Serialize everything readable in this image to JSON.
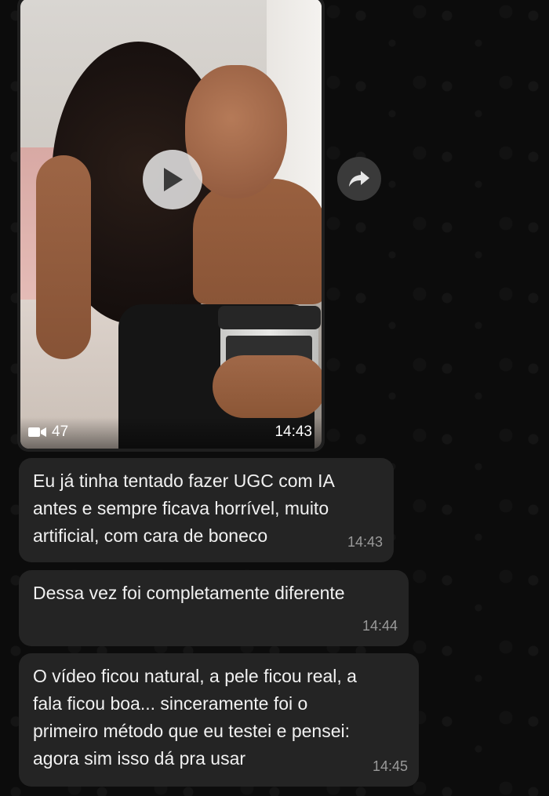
{
  "video_message": {
    "duration": "47",
    "time": "14:43",
    "play_icon": "play-icon",
    "video_icon": "video-camera-icon",
    "forward_icon": "forward-icon"
  },
  "messages": [
    {
      "text": "Eu já tinha tentado fazer UGC com IA\nantes e sempre ficava horrível, muito\nartificial, com cara de boneco",
      "time": "14:43"
    },
    {
      "text": "Dessa vez foi completamente diferente",
      "time": "14:44"
    },
    {
      "text": "O vídeo ficou natural, a pele ficou real, a\nfala ficou boa... sinceramente foi o\nprimeiro método que eu testei e pensei:\nagora sim isso dá pra usar",
      "time": "14:45"
    }
  ],
  "colors": {
    "background": "#0c0c0c",
    "bubble": "#242424",
    "text": "#f1f1f1",
    "timestamp": "#9a9a9a"
  }
}
